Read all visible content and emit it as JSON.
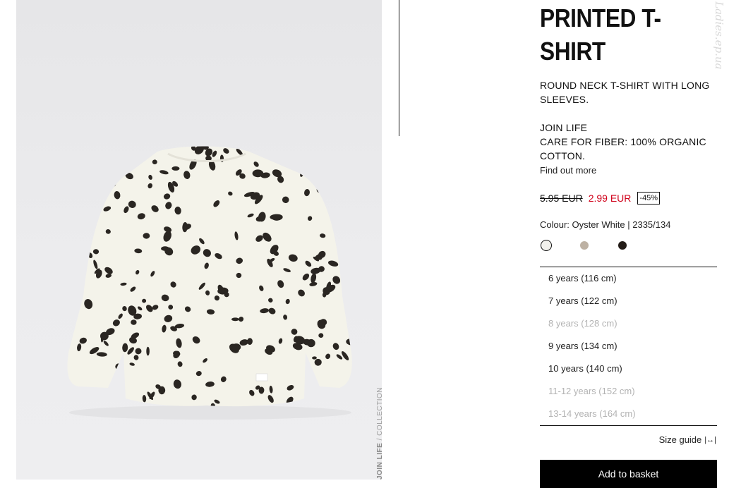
{
  "product": {
    "title": "PRINTED T-SHIRT",
    "title_line1": "PRINTED T-",
    "title_line2": "SHIRT",
    "description": "ROUND NECK T-SHIRT WITH LONG SLEEVES.",
    "join_life_heading": "JOIN LIFE",
    "join_life_text": "CARE FOR FIBER: 100% ORGANIC COTTON.",
    "find_out_more": "Find out more",
    "old_price": "5.95 EUR",
    "new_price": "2.99 EUR",
    "discount": "-45%",
    "colour_label": "Colour: Oyster White | 2335/134"
  },
  "photo": {
    "collection_tag_bold": "JOIN LIFE",
    "collection_tag_rest": " / COLLECTION"
  },
  "colours": [
    {
      "name": "oyster-white",
      "hex": "#f2f1ec",
      "selected": true
    },
    {
      "name": "beige",
      "hex": "#bdb1a3",
      "selected": false
    },
    {
      "name": "black",
      "hex": "#231c17",
      "selected": false
    }
  ],
  "sizes": [
    {
      "label": "6 years (116 cm)",
      "available": true
    },
    {
      "label": "7 years (122 cm)",
      "available": true
    },
    {
      "label": "8 years (128 cm)",
      "available": false
    },
    {
      "label": "9 years (134 cm)",
      "available": true
    },
    {
      "label": "10 years (140 cm)",
      "available": true
    },
    {
      "label": "11-12 years (152 cm)",
      "available": false
    },
    {
      "label": "13-14 years (164 cm)",
      "available": false
    }
  ],
  "size_guide_label": "Size guide",
  "size_guide_icon": "arrows-horizontal-icon",
  "add_to_basket_label": "Add to basket",
  "watermark": "Ladies.ep.ua",
  "colors": {
    "sale_red": "#d0021b",
    "button_black": "#000000",
    "disabled_grey": "#b3b3b3"
  }
}
